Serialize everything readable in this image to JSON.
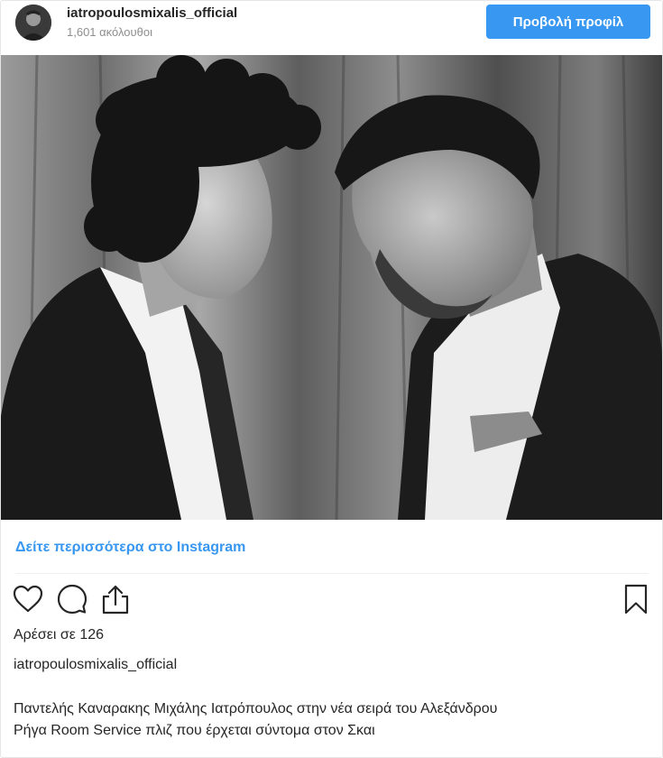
{
  "header": {
    "username": "iatropoulosmixalis_official",
    "followers": "1,601 ακόλουθοι",
    "view_profile_label": "Προβολή προφίλ",
    "avatar_icon": "profile-photo",
    "accent_color": "#3897f0"
  },
  "post": {
    "photo": {
      "style": "black-and-white"
    },
    "more_link": "Δείτε περισσότερα στο Instagram",
    "actions": {
      "like_icon": "heart-icon",
      "comment_icon": "comment-bubble-icon",
      "share_icon": "share-upload-icon",
      "save_icon": "bookmark-icon"
    },
    "likes": "Αρέσει σε 126",
    "caption_username": "iatropoulosmixalis_official",
    "caption_line1": "Παντελής Καναρακης Μιχάλης Ιατρόπουλος στην νέα σειρά του Αλεξάνδρου",
    "caption_line2": "Ρήγα Room Service πλιζ που έρχεται σύντομα στον Σκαι"
  }
}
